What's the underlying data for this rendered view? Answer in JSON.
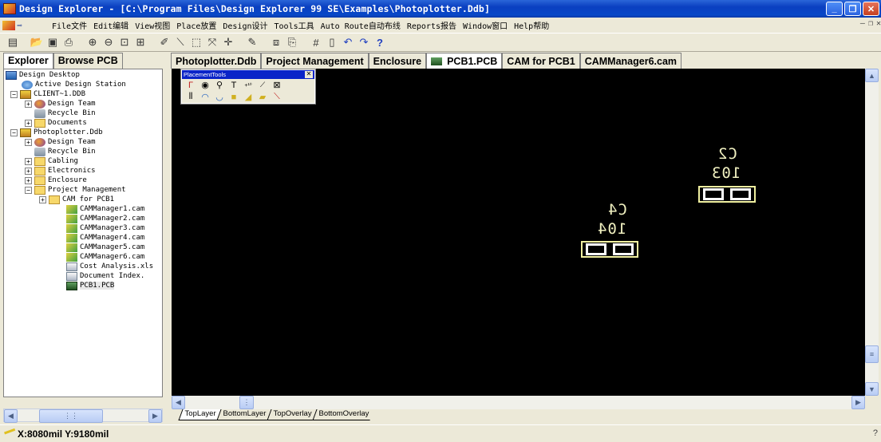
{
  "window": {
    "title": "Design Explorer - [C:\\Program Files\\Design Explorer 99 SE\\Examples\\Photoplotter.Ddb]",
    "min_icon": "minimize-icon",
    "max_icon": "maximize-icon",
    "close_icon": "close-icon"
  },
  "menu": {
    "items": [
      "File文件",
      "Edit编辑",
      "View视图",
      "Place放置",
      "Design设计",
      "Tools工具",
      "Auto Route自动布线",
      "Reports报告",
      "Window窗口",
      "Help帮助"
    ]
  },
  "panel": {
    "tabs": [
      "Explorer",
      "Browse PCB"
    ]
  },
  "tree": {
    "items": [
      {
        "label": "Design Desktop",
        "icon": "desktop-icon"
      },
      {
        "label": "Active Design Station",
        "icon": "station-icon"
      },
      {
        "label": "CLIENT~1.DDB",
        "icon": "database-icon"
      },
      {
        "label": "Design Team",
        "icon": "team-icon"
      },
      {
        "label": "Recycle Bin",
        "icon": "recycle-bin-icon"
      },
      {
        "label": "Documents",
        "icon": "folder-icon"
      },
      {
        "label": "Photoplotter.Ddb",
        "icon": "database-icon"
      },
      {
        "label": "Design Team",
        "icon": "team-icon"
      },
      {
        "label": "Recycle Bin",
        "icon": "recycle-bin-icon"
      },
      {
        "label": "Cabling",
        "icon": "folder-icon"
      },
      {
        "label": "Electronics",
        "icon": "folder-icon"
      },
      {
        "label": "Enclosure",
        "icon": "folder-icon"
      },
      {
        "label": "Project Management",
        "icon": "folder-open-icon"
      },
      {
        "label": "CAM for PCB1",
        "icon": "folder-icon"
      },
      {
        "label": "CAMManager1.cam",
        "icon": "cam-icon"
      },
      {
        "label": "CAMManager2.cam",
        "icon": "cam-icon"
      },
      {
        "label": "CAMManager3.cam",
        "icon": "cam-icon"
      },
      {
        "label": "CAMManager4.cam",
        "icon": "cam-icon"
      },
      {
        "label": "CAMManager5.cam",
        "icon": "cam-icon"
      },
      {
        "label": "CAMManager6.cam",
        "icon": "cam-icon"
      },
      {
        "label": "Cost Analysis.xls",
        "icon": "document-icon"
      },
      {
        "label": "Document Index.",
        "icon": "document-icon"
      },
      {
        "label": "PCB1.PCB",
        "icon": "pcb-icon"
      }
    ]
  },
  "documents": {
    "tabs": [
      "Photoplotter.Ddb",
      "Project Management",
      "Enclosure",
      "PCB1.PCB",
      "CAM for PCB1",
      "CAMManager6.cam"
    ],
    "active": "PCB1.PCB"
  },
  "palette": {
    "title": "PlacementTools"
  },
  "board": {
    "components": [
      {
        "designator": "C2",
        "comment": "103"
      },
      {
        "designator": "C4",
        "comment": "104"
      }
    ],
    "silk_color": "#f0f0c0",
    "background": "#000000"
  },
  "layers": {
    "tabs": [
      "TopLayer",
      "BottomLayer",
      "TopOverlay",
      "BottomOverlay"
    ],
    "active": "TopLayer"
  },
  "status": {
    "coords": "X:8080mil Y:9180mil"
  }
}
